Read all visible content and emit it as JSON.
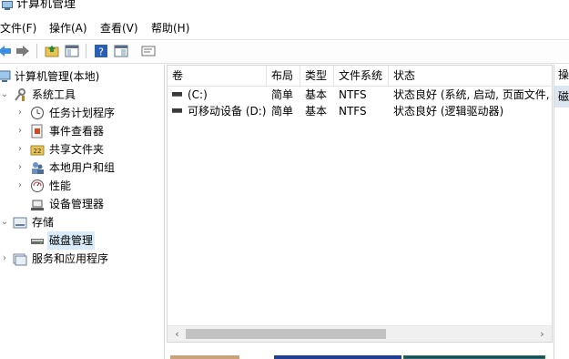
{
  "window": {
    "title": "计算机管理"
  },
  "menu": [
    {
      "label": "文件(F)"
    },
    {
      "label": "操作(A)"
    },
    {
      "label": "查看(V)"
    },
    {
      "label": "帮助(H)"
    }
  ],
  "toolbar": {
    "icons": [
      "back-arrow-icon",
      "forward-arrow-icon",
      "up-folder-icon",
      "show-hide-tree-icon",
      "help-icon",
      "properties-icon",
      "export-list-icon"
    ]
  },
  "tree": {
    "items": [
      {
        "label": "计算机管理(本地)",
        "icon": "computer-management-icon"
      },
      {
        "label": "系统工具",
        "icon": "system-tools-icon"
      },
      {
        "label": "任务计划程序",
        "icon": "task-scheduler-icon"
      },
      {
        "label": "事件查看器",
        "icon": "event-viewer-icon"
      },
      {
        "label": "共享文件夹",
        "icon": "shared-folders-icon"
      },
      {
        "label": "本地用户和组",
        "icon": "local-users-groups-icon"
      },
      {
        "label": "性能",
        "icon": "performance-icon"
      },
      {
        "label": "设备管理器",
        "icon": "device-manager-icon"
      },
      {
        "label": "存储",
        "icon": "storage-icon"
      },
      {
        "label": "磁盘管理",
        "icon": "disk-management-icon"
      },
      {
        "label": "服务和应用程序",
        "icon": "services-applications-icon"
      }
    ]
  },
  "list": {
    "columns": [
      "卷",
      "布局",
      "类型",
      "文件系统",
      "状态"
    ],
    "rows": [
      {
        "volume": "(C:)",
        "layout": "简单",
        "type": "基本",
        "fs": "NTFS",
        "status": "状态良好 (系统, 启动, 页面文件,"
      },
      {
        "volume": "可移动设备 (D:)",
        "layout": "简单",
        "type": "基本",
        "fs": "NTFS",
        "status": "状态良好 (逻辑驱动器)"
      }
    ]
  },
  "actions": {
    "header": "操",
    "item": "磁"
  },
  "colors": {
    "selection": "#d9ebf9",
    "action_highlight": "#dce6f0",
    "disk_primary": "#1f3f8f",
    "disk_logical": "#2e7d32",
    "disk_unalloc": "#c8a27a"
  }
}
